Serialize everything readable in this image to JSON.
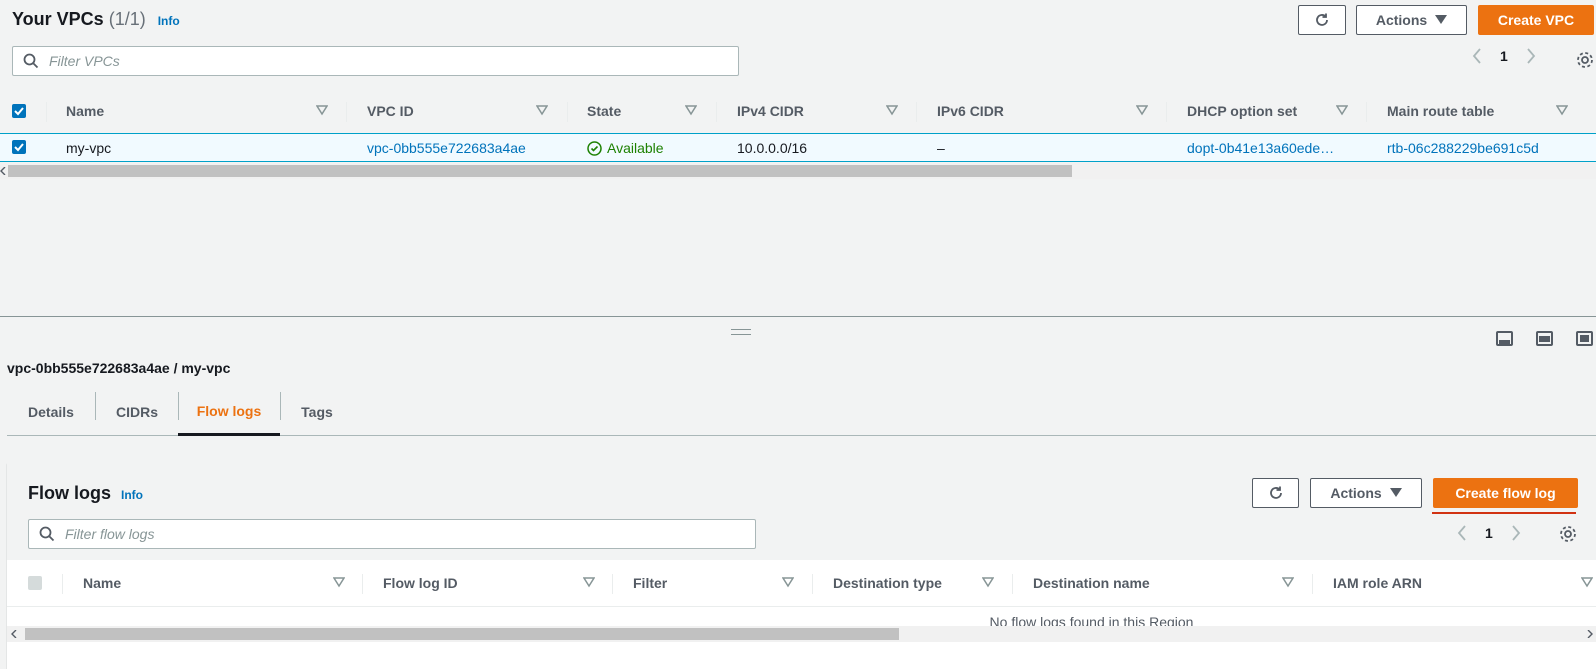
{
  "vpc_list": {
    "title": "Your VPCs",
    "count": "(1/1)",
    "info": "Info",
    "refresh_icon": "refresh-icon",
    "actions_label": "Actions",
    "create_label": "Create VPC",
    "filter_placeholder": "Filter VPCs",
    "page": "1",
    "columns": [
      "Name",
      "VPC ID",
      "State",
      "IPv4 CIDR",
      "IPv6 CIDR",
      "DHCP option set",
      "Main route table"
    ],
    "rows": [
      {
        "name": "my-vpc",
        "vpc_id": "vpc-0bb555e722683a4ae",
        "state": "Available",
        "ipv4": "10.0.0.0/16",
        "ipv6": "–",
        "dhcp": "dopt-0b41e13a60ede…",
        "route_table": "rtb-06c288229be691c5d"
      }
    ]
  },
  "detail": {
    "title": "vpc-0bb555e722683a4ae / my-vpc",
    "tabs": [
      "Details",
      "CIDRs",
      "Flow logs",
      "Tags"
    ],
    "active_tab": "Flow logs"
  },
  "flow_logs": {
    "title": "Flow logs",
    "info": "Info",
    "actions_label": "Actions",
    "create_label": "Create flow log",
    "filter_placeholder": "Filter flow logs",
    "page": "1",
    "columns": [
      "Name",
      "Flow log ID",
      "Filter",
      "Destination type",
      "Destination name",
      "IAM role ARN"
    ],
    "empty_message": "No flow logs found in this Region"
  },
  "colors": {
    "accent": "#ec7211",
    "link": "#0073bb",
    "success": "#1d8102",
    "highlight": "#d13212"
  }
}
